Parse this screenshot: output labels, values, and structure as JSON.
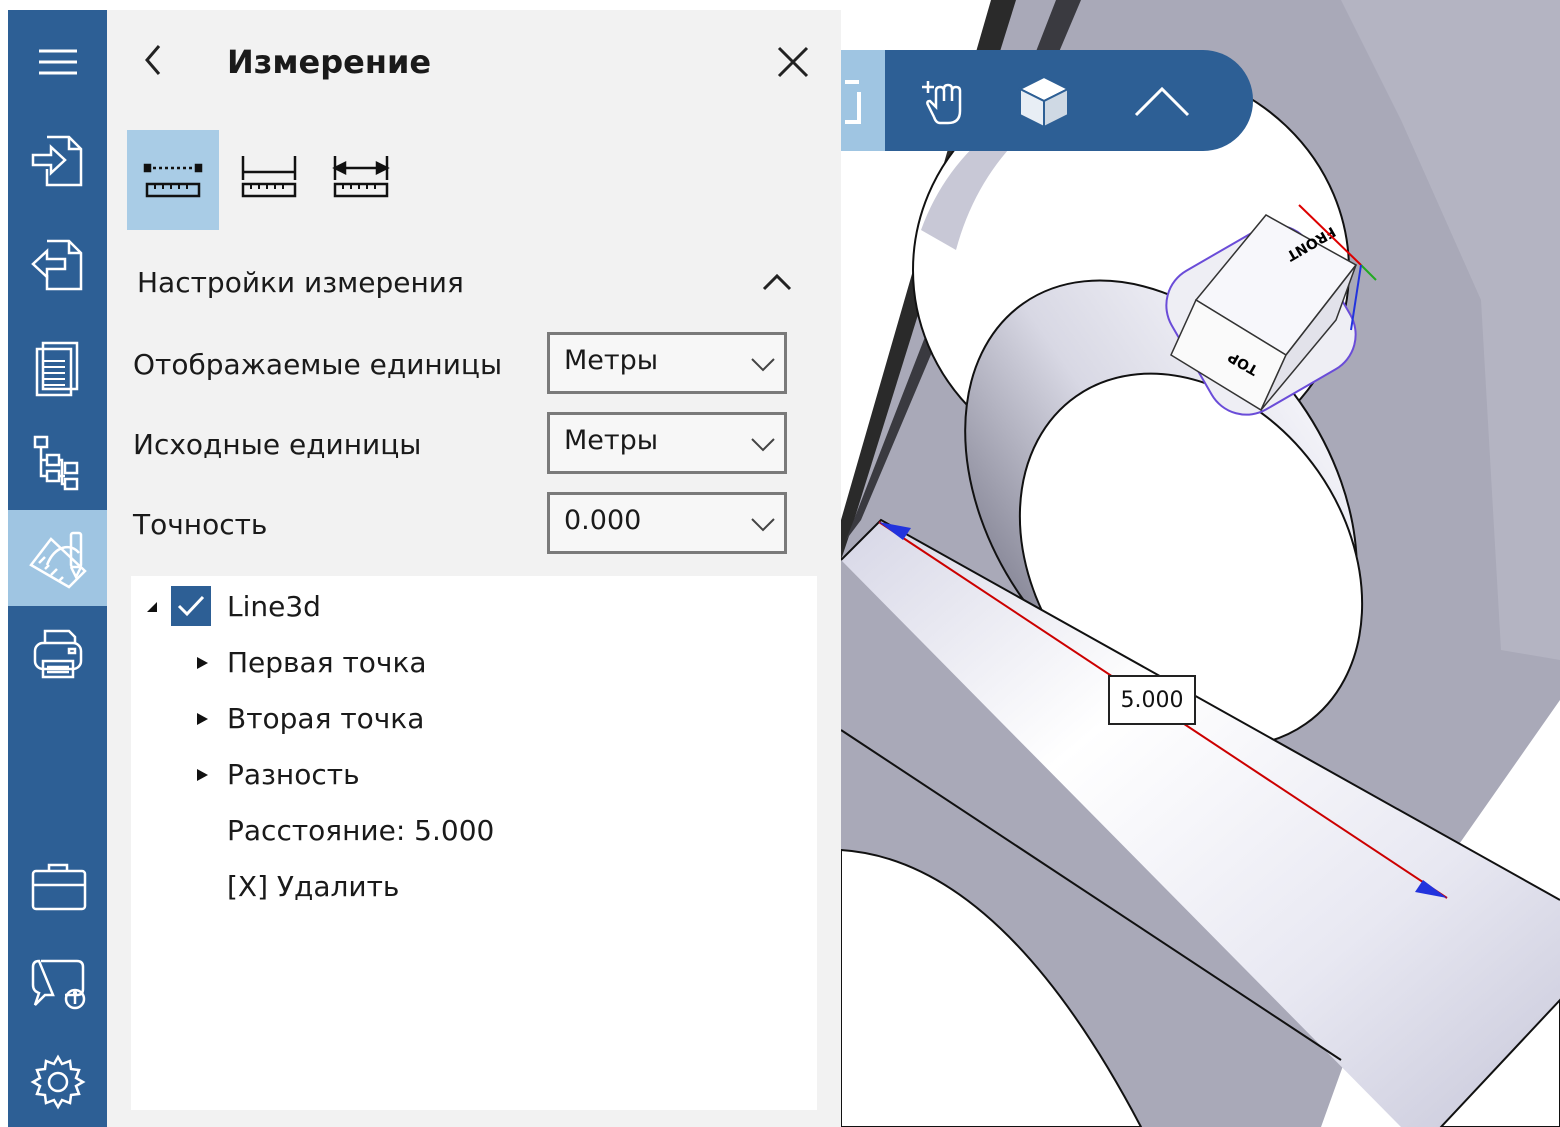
{
  "rail": {
    "items": [
      {
        "icon": "menu-icon"
      },
      {
        "icon": "import-icon"
      },
      {
        "icon": "export-icon"
      },
      {
        "icon": "document-icon"
      },
      {
        "icon": "tree-structure-icon"
      },
      {
        "icon": "measure-icon",
        "active": true
      },
      {
        "icon": "print-icon"
      },
      {
        "icon": "briefcase-icon"
      },
      {
        "icon": "feedback-icon"
      },
      {
        "icon": "gear-icon"
      }
    ]
  },
  "panel": {
    "title": "Измерение",
    "modes": [
      {
        "icon": "point-to-point-ruler-icon",
        "active": true
      },
      {
        "icon": "edge-ruler-icon"
      },
      {
        "icon": "distance-ruler-icon"
      }
    ],
    "settings": {
      "title": "Настройки измерения",
      "fields": [
        {
          "label": "Отображаемые единицы",
          "value": "Метры"
        },
        {
          "label": "Исходные единицы",
          "value": "Метры"
        },
        {
          "label": "Точность",
          "value": "0.000"
        }
      ]
    },
    "tree": {
      "root": {
        "label": "Line3d",
        "checked": true
      },
      "children": [
        {
          "label": "Первая точка"
        },
        {
          "label": "Вторая точка"
        },
        {
          "label": "Разность"
        }
      ],
      "distance": "Расстояние: 5.000",
      "delete": "[X] Удалить"
    }
  },
  "viewport": {
    "toolbar": [
      "pan-hand-icon",
      "view-cube-icon",
      "collapse-chevron-icon"
    ],
    "view_cube": {
      "front": "FRONT",
      "top": "TOP"
    },
    "measurement_label": "5.000",
    "colors": {
      "rail": "#2d5f95",
      "active": "#9fc5e2",
      "face": "#a9a9b8",
      "measure_line": "#cc0000",
      "arrow": "#2233dd"
    }
  }
}
